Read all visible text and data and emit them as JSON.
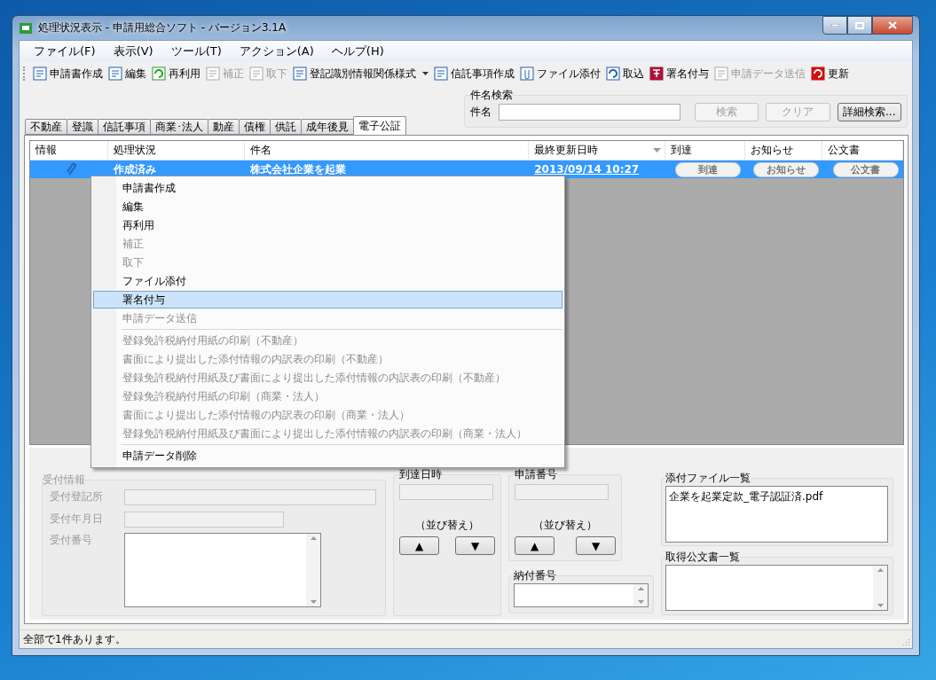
{
  "window": {
    "title": "処理状況表示 - 申請用総合ソフト - バージョン3.1A"
  },
  "menu_bar": [
    {
      "label": "ファイル(F)"
    },
    {
      "label": "表示(V)"
    },
    {
      "label": "ツール(T)"
    },
    {
      "label": "アクション(A)"
    },
    {
      "label": "ヘルプ(H)"
    }
  ],
  "toolbar": [
    {
      "label": "申請書作成",
      "disabled": false,
      "dropdown": false
    },
    {
      "label": "編集",
      "disabled": false,
      "dropdown": false
    },
    {
      "label": "再利用",
      "disabled": false,
      "dropdown": false
    },
    {
      "label": "補正",
      "disabled": true,
      "dropdown": false
    },
    {
      "label": "取下",
      "disabled": true,
      "dropdown": false
    },
    {
      "label": "登記識別情報関係様式",
      "disabled": false,
      "dropdown": true
    },
    {
      "label": "信託事項作成",
      "disabled": false,
      "dropdown": false
    },
    {
      "label": "ファイル添付",
      "disabled": false,
      "dropdown": false
    },
    {
      "label": "取込",
      "disabled": false,
      "dropdown": false
    },
    {
      "label": "署名付与",
      "disabled": false,
      "dropdown": false
    },
    {
      "label": "申請データ送信",
      "disabled": true,
      "dropdown": false
    },
    {
      "label": "更新",
      "disabled": false,
      "dropdown": false
    }
  ],
  "search": {
    "title": "件名検索",
    "label": "件名",
    "buttons": [
      {
        "label": "検索",
        "disabled": true
      },
      {
        "label": "クリア",
        "disabled": true
      },
      {
        "label": "詳細検索...",
        "disabled": false
      }
    ]
  },
  "tabs": [
    {
      "label": "不動産",
      "selected": false
    },
    {
      "label": "登識",
      "selected": false
    },
    {
      "label": "信託事項",
      "selected": false
    },
    {
      "label": "商業･法人",
      "selected": false
    },
    {
      "label": "動産",
      "selected": false
    },
    {
      "label": "債権",
      "selected": false
    },
    {
      "label": "供託",
      "selected": false
    },
    {
      "label": "成年後見",
      "selected": false
    },
    {
      "label": "電子公証",
      "selected": true
    }
  ],
  "table": {
    "columns": [
      {
        "label": "情報",
        "sorted": false
      },
      {
        "label": "処理状況",
        "sorted": false
      },
      {
        "label": "件名",
        "sorted": false
      },
      {
        "label": "最終更新日時",
        "sorted": true
      },
      {
        "label": "到達",
        "sorted": false
      },
      {
        "label": "お知らせ",
        "sorted": false
      },
      {
        "label": "公文書",
        "sorted": false
      }
    ],
    "rows": [
      {
        "selected": true,
        "attachment": true,
        "status": "作成済み",
        "subject": "株式会社企業を起業",
        "updated": "2013/09/14 10:27",
        "buttons": [
          "到達",
          "お知らせ",
          "公文書"
        ]
      }
    ]
  },
  "context_menu": [
    {
      "kind": "item",
      "label": "申請書作成",
      "disabled": false,
      "selected": false
    },
    {
      "kind": "item",
      "label": "編集",
      "disabled": false,
      "selected": false
    },
    {
      "kind": "item",
      "label": "再利用",
      "disabled": false,
      "selected": false
    },
    {
      "kind": "item",
      "label": "補正",
      "disabled": true,
      "selected": false
    },
    {
      "kind": "item",
      "label": "取下",
      "disabled": true,
      "selected": false
    },
    {
      "kind": "item",
      "label": "ファイル添付",
      "disabled": false,
      "selected": false
    },
    {
      "kind": "item",
      "label": "署名付与",
      "disabled": false,
      "selected": true
    },
    {
      "kind": "item",
      "label": "申請データ送信",
      "disabled": true,
      "selected": false
    },
    {
      "kind": "separator"
    },
    {
      "kind": "item",
      "label": "登録免許税納付用紙の印刷（不動産）",
      "disabled": true,
      "selected": false
    },
    {
      "kind": "item",
      "label": "書面により提出した添付情報の内訳表の印刷（不動産）",
      "disabled": true,
      "selected": false
    },
    {
      "kind": "item",
      "label": "登録免許税納付用紙及び書面により提出した添付情報の内訳表の印刷（不動産）",
      "disabled": true,
      "selected": false
    },
    {
      "kind": "item",
      "label": "登録免許税納付用紙の印刷（商業・法人）",
      "disabled": true,
      "selected": false
    },
    {
      "kind": "item",
      "label": "書面により提出した添付情報の内訳表の印刷（商業・法人）",
      "disabled": true,
      "selected": false
    },
    {
      "kind": "item",
      "label": "登録免許税納付用紙及び書面により提出した添付情報の内訳表の印刷（商業・法人）",
      "disabled": true,
      "selected": false
    },
    {
      "kind": "separator"
    },
    {
      "kind": "item",
      "label": "申請データ削除",
      "disabled": false,
      "selected": false
    }
  ],
  "receipt": {
    "title": "受付情報",
    "disabled": true,
    "fields": [
      {
        "label": "受付登記所"
      },
      {
        "label": "受付年月日"
      },
      {
        "label": "受付番号"
      }
    ]
  },
  "arrival_time": {
    "title": "到達日時",
    "sort_label": "（並び替え）",
    "up": "▲",
    "down": "▼"
  },
  "application_number": {
    "title": "申請番号",
    "sort_label": "（並び替え）",
    "up": "▲",
    "down": "▼"
  },
  "payment_number": {
    "title": "納付番号"
  },
  "attachments": {
    "title": "添付ファイル一覧",
    "items": [
      "企業を起業定款_電子認証済.pdf"
    ]
  },
  "documents": {
    "title": "取得公文書一覧"
  },
  "status_bar": {
    "text": "全部で1件あります。"
  }
}
